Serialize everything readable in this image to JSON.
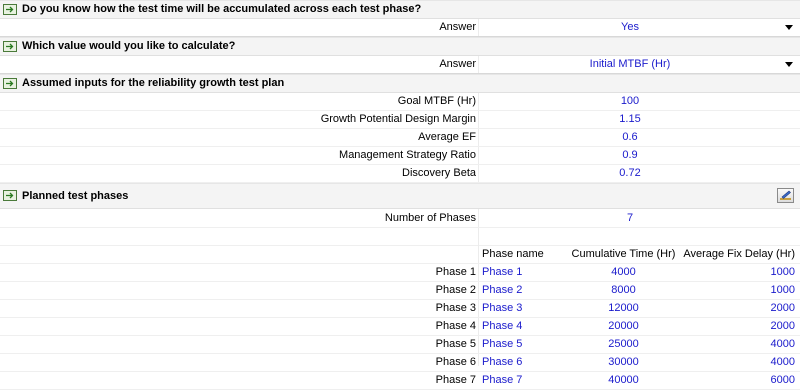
{
  "sections": {
    "test_time": {
      "title": "Do you know how the test time will be accumulated across each test phase?",
      "answer_label": "Answer",
      "answer_value": "Yes"
    },
    "calc_value": {
      "title": "Which value would you like to calculate?",
      "answer_label": "Answer",
      "answer_value": "Initial MTBF (Hr)"
    },
    "inputs": {
      "title": "Assumed inputs for the reliability growth test plan",
      "rows": [
        {
          "label": "Goal MTBF (Hr)",
          "value": "100"
        },
        {
          "label": "Growth Potential Design Margin",
          "value": "1.15"
        },
        {
          "label": "Average EF",
          "value": "0.6"
        },
        {
          "label": "Management Strategy Ratio",
          "value": "0.9"
        },
        {
          "label": "Discovery Beta",
          "value": "0.72"
        }
      ]
    },
    "phases": {
      "title": "Planned test phases",
      "edit_icon": "pencil-ruler-icon",
      "number_label": "Number of Phases",
      "number_value": "7",
      "columns": {
        "name": "Phase name",
        "time": "Cumulative Time (Hr)",
        "delay": "Average Fix Delay (Hr)"
      },
      "rows": [
        {
          "label": "Phase 1",
          "name": "Phase 1",
          "time": "4000",
          "delay": "1000"
        },
        {
          "label": "Phase 2",
          "name": "Phase 2",
          "time": "8000",
          "delay": "1000"
        },
        {
          "label": "Phase 3",
          "name": "Phase 3",
          "time": "12000",
          "delay": "2000"
        },
        {
          "label": "Phase 4",
          "name": "Phase 4",
          "time": "20000",
          "delay": "2000"
        },
        {
          "label": "Phase 5",
          "name": "Phase 5",
          "time": "25000",
          "delay": "4000"
        },
        {
          "label": "Phase 6",
          "name": "Phase 6",
          "time": "30000",
          "delay": "4000"
        },
        {
          "label": "Phase 7",
          "name": "Phase 7",
          "time": "40000",
          "delay": "6000"
        }
      ]
    }
  },
  "colors": {
    "value_text": "#1a1acc",
    "section_bg": "#f4f4f4"
  },
  "icons": {
    "section": "collapse-section-icon",
    "dropdown": "chevron-down-icon"
  }
}
